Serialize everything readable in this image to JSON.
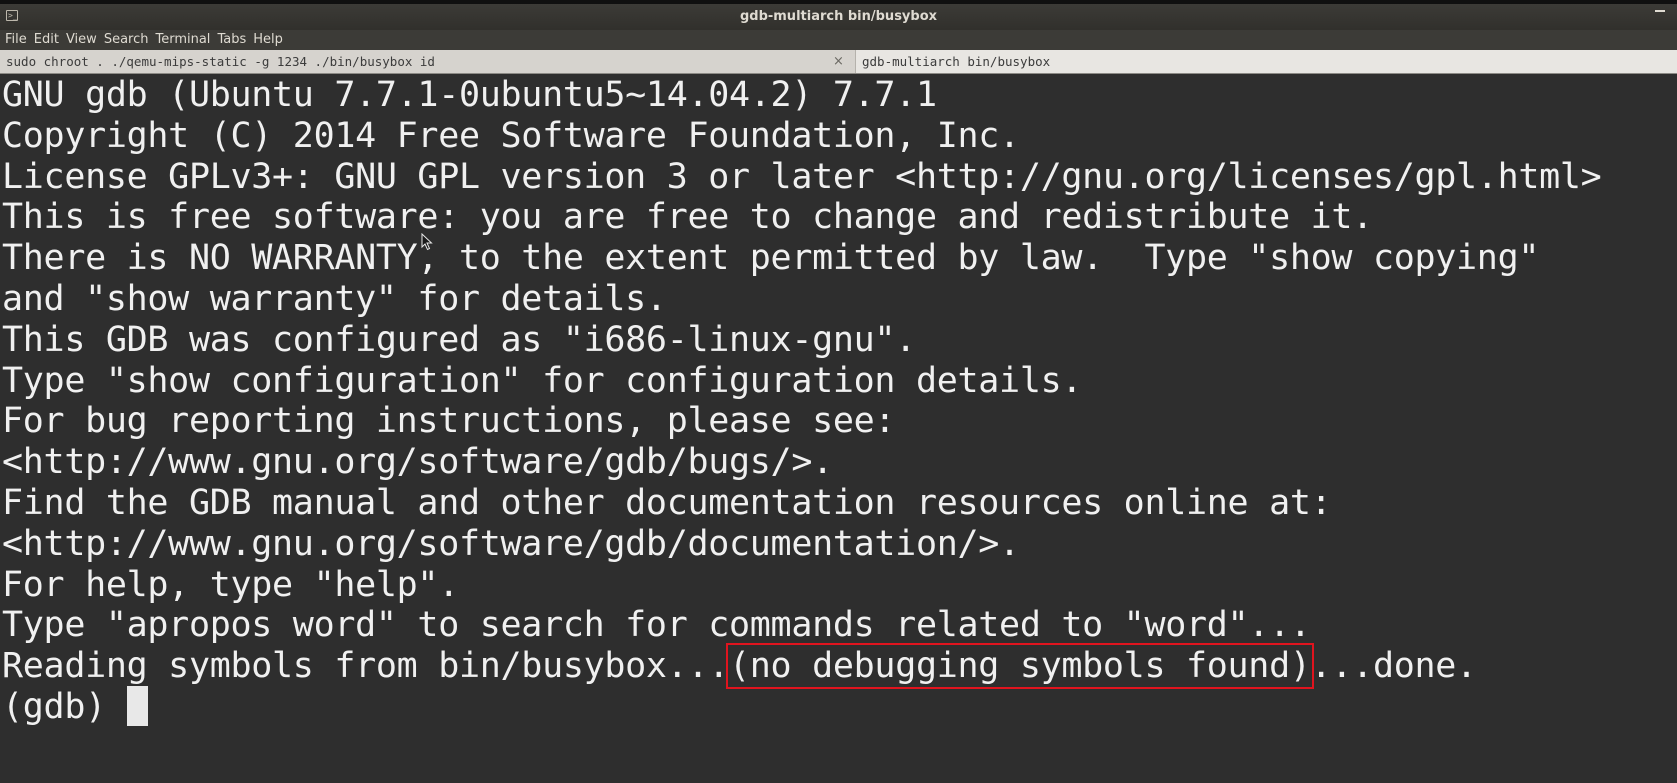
{
  "window": {
    "title": "gdb-multiarch bin/busybox"
  },
  "menubar": {
    "items": [
      "File",
      "Edit",
      "View",
      "Search",
      "Terminal",
      "Tabs",
      "Help"
    ]
  },
  "tabs": [
    {
      "label": "sudo chroot . ./qemu-mips-static -g 1234 ./bin/busybox id",
      "close": "×"
    },
    {
      "label": "gdb-multiarch bin/busybox"
    }
  ],
  "terminal": {
    "lines": [
      "GNU gdb (Ubuntu 7.7.1-0ubuntu5~14.04.2) 7.7.1",
      "Copyright (C) 2014 Free Software Foundation, Inc.",
      "License GPLv3+: GNU GPL version 3 or later <http://gnu.org/licenses/gpl.html>",
      "This is free software: you are free to change and redistribute it.",
      "There is NO WARRANTY, to the extent permitted by law.  Type \"show copying\"",
      "and \"show warranty\" for details.",
      "This GDB was configured as \"i686-linux-gnu\".",
      "Type \"show configuration\" for configuration details.",
      "For bug reporting instructions, please see:",
      "<http://www.gnu.org/software/gdb/bugs/>.",
      "Find the GDB manual and other documentation resources online at:",
      "<http://www.gnu.org/software/gdb/documentation/>.",
      "For help, type \"help\".",
      "Type \"apropos word\" to search for commands related to \"word\"..."
    ],
    "reading_line": {
      "prefix": "Reading symbols from bin/busybox...",
      "highlighted": "(no debugging symbols found)",
      "suffix": "...done."
    },
    "prompt": "(gdb) "
  },
  "colors": {
    "terminal_bg": "#2e2e2e",
    "terminal_fg": "#f0f0f0",
    "highlight_box": "#e0141e"
  }
}
